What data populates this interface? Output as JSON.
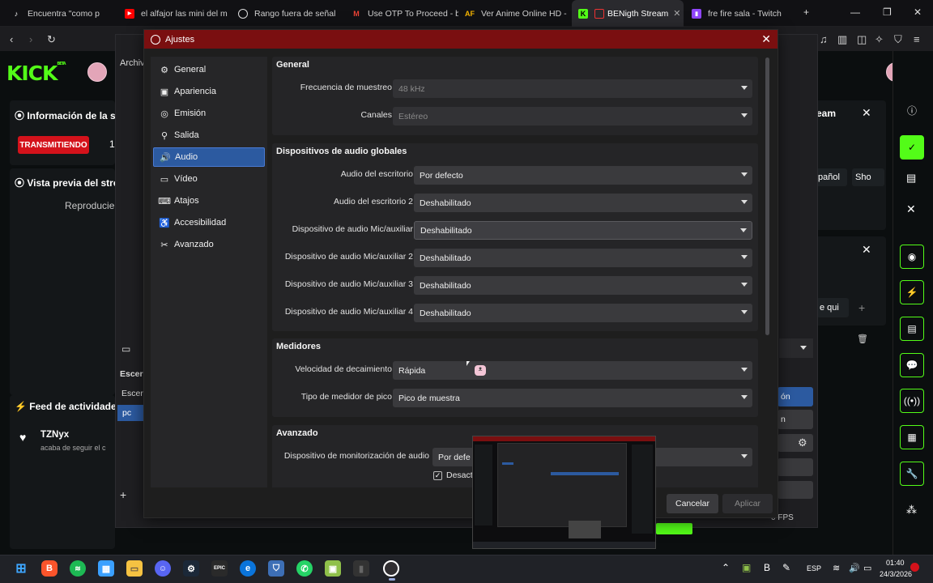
{
  "browser": {
    "tabs": [
      {
        "title": "Encuentra \"como p",
        "favicon": "tiktok-icon"
      },
      {
        "title": "el alfajor las mini del m",
        "favicon": "youtube-icon"
      },
      {
        "title": "Rango fuera de señal",
        "favicon": "chatgpt-icon"
      },
      {
        "title": "Use OTP To Proceed - b",
        "favicon": "gmail-icon"
      },
      {
        "title": "Ver Anime Online HD -",
        "favicon": "anime-icon"
      },
      {
        "title": "BENigth Stream",
        "favicon": "kick-icon"
      },
      {
        "title": "fre fire sala - Twitch",
        "favicon": "twitch-icon"
      }
    ]
  },
  "kick": {
    "logo": "KICK",
    "logo_sup": "BETA",
    "stream_info": "Información de la se",
    "live_badge": "TRANSMITIENDO",
    "live_count": "1",
    "preview_title": "Vista previa del stre",
    "preview_text": "Reproducien",
    "feed_title": "Feed de actividades",
    "follower_name": "TZNyx",
    "follower_text": "acaba de seguir el c",
    "right_panel_title": "eam",
    "right_tag_1": "pañol",
    "right_tag_2": "Sho",
    "right_search": "e qui"
  },
  "obs_main": {
    "menu_archivo": "Archiv",
    "scenes_label": "Escer",
    "scenes_label2": "Escer",
    "scene_item": "pc",
    "fps_text": "0 FPS",
    "button_on": "ón",
    "button_n": "n"
  },
  "dialog": {
    "title": "Ajustes",
    "sidebar": [
      {
        "label": "General",
        "icon": "gear-icon"
      },
      {
        "label": "Apariencia",
        "icon": "palette-icon"
      },
      {
        "label": "Emisión",
        "icon": "broadcast-icon"
      },
      {
        "label": "Salida",
        "icon": "output-icon"
      },
      {
        "label": "Audio",
        "icon": "speaker-icon",
        "selected": true
      },
      {
        "label": "Vídeo",
        "icon": "monitor-icon"
      },
      {
        "label": "Atajos",
        "icon": "keyboard-icon"
      },
      {
        "label": "Accesibilidad",
        "icon": "accessibility-icon"
      },
      {
        "label": "Avanzado",
        "icon": "wrench-icon"
      }
    ],
    "general": {
      "title": "General",
      "sample_rate_label": "Frecuencia de muestreo",
      "sample_rate_value": "48 kHz",
      "channels_label": "Canales",
      "channels_value": "Estéreo"
    },
    "global_audio": {
      "title": "Dispositivos de audio globales",
      "rows": [
        {
          "label": "Audio del escritorio",
          "value": "Por defecto"
        },
        {
          "label": "Audio del escritorio 2",
          "value": "Deshabilitado"
        },
        {
          "label": "Dispositivo de audio Mic/auxiliar",
          "value": "Deshabilitado"
        },
        {
          "label": "Dispositivo de audio Mic/auxiliar 2",
          "value": "Deshabilitado"
        },
        {
          "label": "Dispositivo de audio Mic/auxiliar 3",
          "value": "Deshabilitado"
        },
        {
          "label": "Dispositivo de audio Mic/auxiliar 4",
          "value": "Deshabilitado"
        }
      ]
    },
    "meters": {
      "title": "Medidores",
      "decay_label": "Velocidad de decaimiento",
      "decay_value": "Rápida",
      "peak_label": "Tipo de medidor de pico",
      "peak_value": "Pico de muestra"
    },
    "advanced": {
      "title": "Avanzado",
      "monitor_label": "Dispositivo de monitorización de audio",
      "monitor_value": "Por defe",
      "checkbox_label": "Desact"
    },
    "buttons": {
      "cancel": "Cancelar",
      "apply": "Aplicar"
    }
  },
  "taskbar": {
    "language": "ESP",
    "time": "01:40",
    "date": "24/3/2026",
    "epic_label": "EPIC"
  },
  "colors": {
    "kick_green": "#53fc18",
    "obs_titlebar": "#7a0f10",
    "selected_item": "#2c5aa0",
    "live_red": "#d4121b"
  }
}
